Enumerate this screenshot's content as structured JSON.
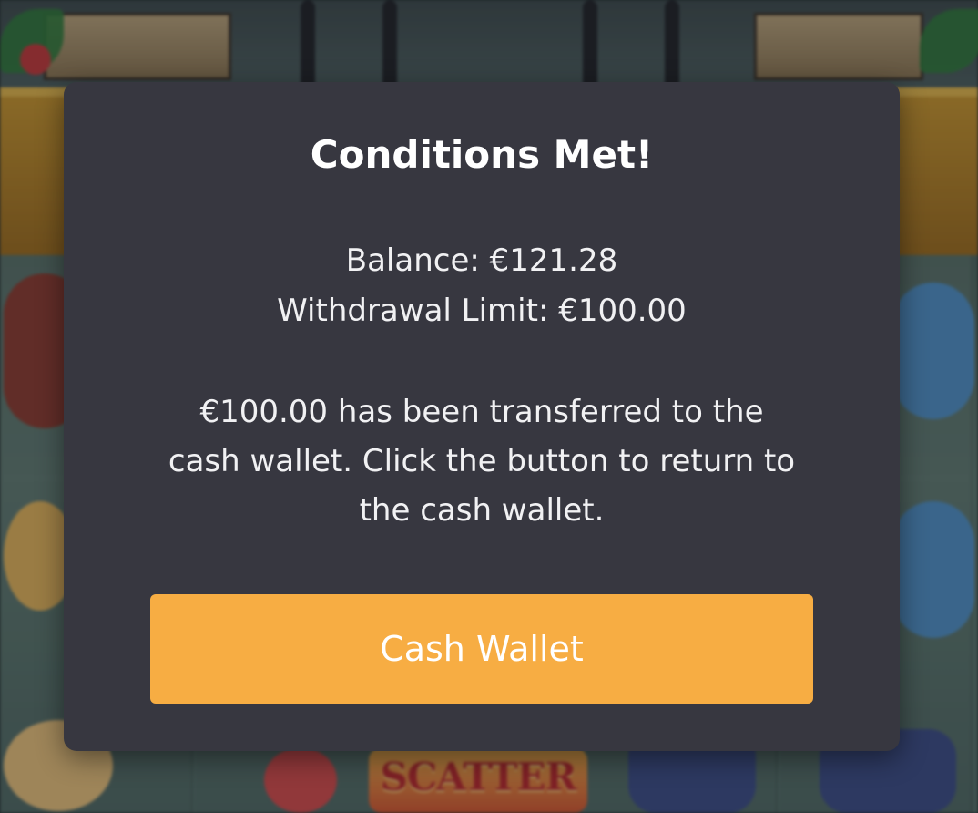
{
  "dialog": {
    "title": "Conditions Met!",
    "balance_text": "Balance: €121.28",
    "limit_text": "Withdrawal Limit: €100.00",
    "message": "€100.00 has been transferred to the cash wallet. Click the button to return to the cash wallet.",
    "button_label": "Cash Wallet"
  },
  "background": {
    "scatter_symbol_text": "SCATTER"
  },
  "colors": {
    "modal_bg": "#373740",
    "button_bg": "#f7ad43",
    "text": "#ffffff"
  }
}
